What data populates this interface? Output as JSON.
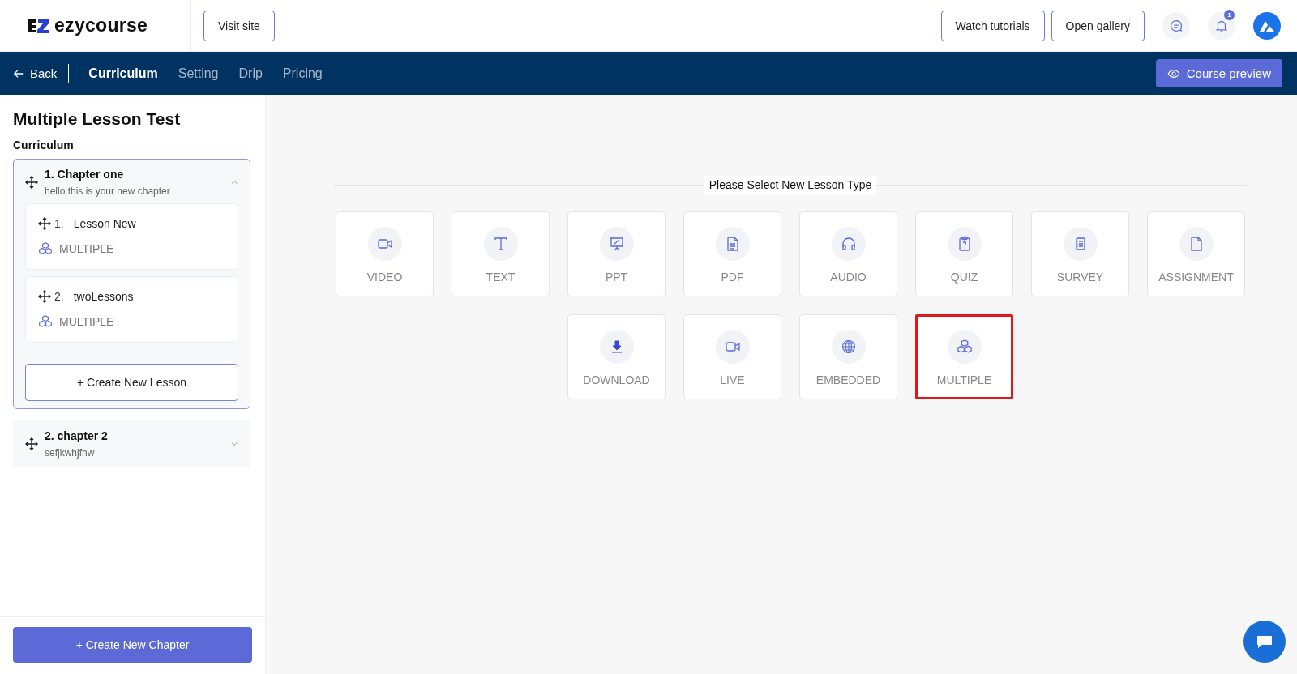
{
  "header": {
    "logo": "ezycourse",
    "buttons": [
      "Visit site",
      "Watch tutorials",
      "Open gallery"
    ],
    "notification_count": "1"
  },
  "nav": {
    "back": "Back",
    "tabs": [
      {
        "label": "Curriculum",
        "selected": true
      },
      {
        "label": "Setting",
        "selected": false
      },
      {
        "label": "Drip",
        "selected": false
      },
      {
        "label": "Pricing",
        "selected": false
      }
    ],
    "preview": "Course preview"
  },
  "sidebar": {
    "title": "Multiple Lesson Test",
    "subtitle": "Curriculum",
    "chapters": [
      {
        "title": "1. Chapter one",
        "description": "hello this is your new chapter",
        "expanded": true,
        "lessons": [
          {
            "number": "1.",
            "title": "Lesson New",
            "type": "MULTIPLE"
          },
          {
            "number": "2.",
            "title": "twoLessons",
            "type": "MULTIPLE"
          }
        ],
        "create_lesson": "+ Create New Lesson"
      },
      {
        "title": "2. chapter 2",
        "description": "sefjkwhjfhw",
        "expanded": false
      }
    ],
    "create_chapter": "+ Create New Chapter"
  },
  "main": {
    "heading": "Please Select New Lesson Type",
    "lesson_types": [
      {
        "kind": "video",
        "label": "VIDEO",
        "highlighted": false
      },
      {
        "kind": "text",
        "label": "TEXT",
        "highlighted": false
      },
      {
        "kind": "ppt",
        "label": "PPT",
        "highlighted": false
      },
      {
        "kind": "pdf",
        "label": "PDF",
        "highlighted": false
      },
      {
        "kind": "audio",
        "label": "AUDIO",
        "highlighted": false
      },
      {
        "kind": "quiz",
        "label": "QUIZ",
        "highlighted": false
      },
      {
        "kind": "survey",
        "label": "SURVEY",
        "highlighted": false
      },
      {
        "kind": "assignment",
        "label": "ASSIGNMENT",
        "highlighted": false
      },
      {
        "kind": "download",
        "label": "DOWNLOAD",
        "highlighted": false
      },
      {
        "kind": "live",
        "label": "LIVE",
        "highlighted": false
      },
      {
        "kind": "embedded",
        "label": "EMBEDDED",
        "highlighted": false
      },
      {
        "kind": "multiple",
        "label": "MULTIPLE",
        "highlighted": true
      }
    ]
  }
}
